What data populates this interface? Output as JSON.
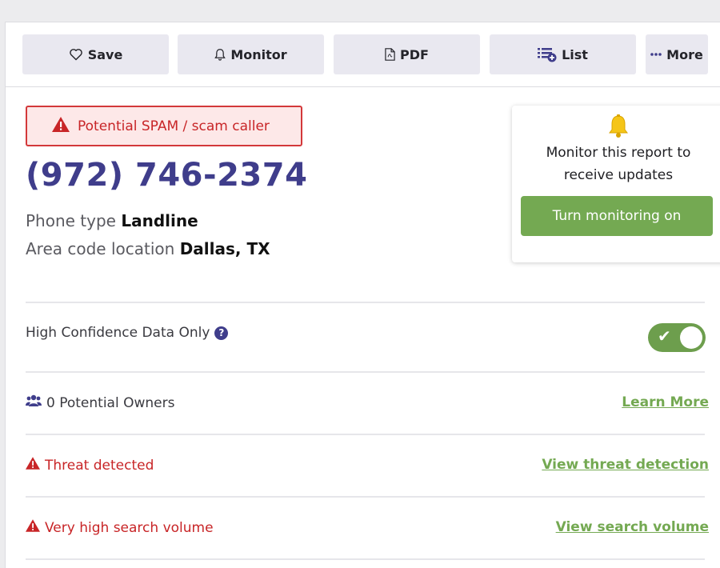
{
  "toolbar": {
    "save_label": "Save",
    "monitor_label": "Monitor",
    "pdf_label": "PDF",
    "list_label": "List",
    "more_label": "More"
  },
  "report": {
    "alert_text": "Potential SPAM / scam caller",
    "phone_number": "(972) 746-2374",
    "phone_type_label": "Phone type",
    "phone_type_value": "Landline",
    "area_label": "Area code location",
    "area_value": "Dallas, TX"
  },
  "monitor_card": {
    "text": "Monitor this report to receive updates",
    "button_label": "Turn monitoring on"
  },
  "rows": {
    "confidence_label": "High Confidence Data Only",
    "confidence_help": "?",
    "confidence_enabled": true,
    "owners_label": "0 Potential Owners",
    "owners_link": "Learn More",
    "threat_label": "Threat detected",
    "threat_link": "View threat detection",
    "volume_label": "Very high search volume",
    "volume_link": "View search volume"
  },
  "colors": {
    "accent_purple": "#3f3d8b",
    "alert_red": "#c82527",
    "success_green": "#74a952"
  },
  "icons": [
    "heart-icon",
    "bell-icon",
    "pdf-file-icon",
    "list-add-icon",
    "more-dots-icon",
    "warning-icon",
    "users-icon",
    "question-icon",
    "check-icon"
  ]
}
